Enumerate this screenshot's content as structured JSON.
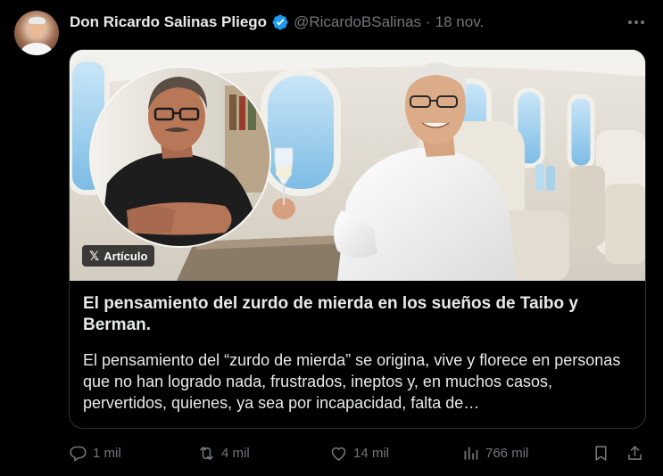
{
  "author": {
    "name": "Don Ricardo Salinas Pliego",
    "handle": "@RicardoBSalinas",
    "separator": "·",
    "date": "18 nov."
  },
  "card": {
    "badge_label": "Artículo",
    "title": "El pensamiento del zurdo de mierda en los sueños de Taibo y Berman.",
    "description": "El pensamiento del “zurdo de mierda” se origina, vive y florece en personas que no han logrado nada, frustrados, ineptos y, en muchos casos, pervertidos, quienes, ya sea por incapacidad, falta de…"
  },
  "actions": {
    "replies": "1 mil",
    "reposts": "4 mil",
    "likes": "14 mil",
    "views": "766 mil"
  },
  "icons": {
    "verified": "verified-badge-icon",
    "more": "more-options-icon",
    "reply": "reply-icon",
    "repost": "repost-icon",
    "like": "heart-icon",
    "views": "views-chart-icon",
    "bookmark": "bookmark-icon",
    "share": "share-icon",
    "x_logo": "x-logo-icon"
  },
  "colors": {
    "background": "#000000",
    "text_primary": "#e7e9ea",
    "text_secondary": "#71767b",
    "verified_blue": "#1d9bf0",
    "border": "#2f3336"
  }
}
